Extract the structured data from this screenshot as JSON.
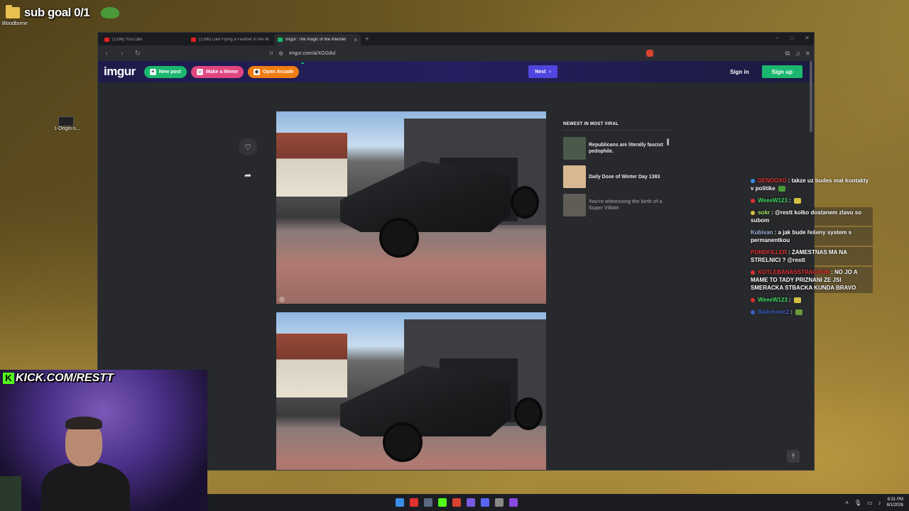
{
  "desktop": {
    "sub_goal": "sub goal 0/1",
    "folder_label": "Bloodborne",
    "app_label": "1-Origin-s..."
  },
  "browser": {
    "tabs": [
      {
        "title": "(1396) YouTube",
        "favicon_color": "#e02020",
        "active": false
      },
      {
        "title": "(1396) Like Flying a Feather in the W",
        "favicon_color": "#e02020",
        "active": false
      },
      {
        "title": "imgur: The magic of the Internet",
        "favicon_color": "#1bb76e",
        "active": true
      }
    ],
    "url": "imgur.com/a/XGGdul"
  },
  "imgur": {
    "logo": "imgur",
    "new_post": "New post",
    "make_meme": "Make a Meme",
    "open_arcade": "Open Arcade",
    "arcade_badge": "",
    "next": "Next",
    "sign_in": "Sign in",
    "sign_up": "Sign up",
    "viral_heading": "NEWEST IN MOST VIRAL",
    "viral_items": [
      {
        "title": "Republicans are literally fascist pedophile.",
        "thumb_color": "#4a5a4a"
      },
      {
        "title": "Daily Dose of Winter Day 1383",
        "thumb_color": "#d8b890"
      },
      {
        "title": "You're witnessing the birth of a Super Villain",
        "thumb_color": "#9a9080"
      }
    ]
  },
  "chat": [
    {
      "user": "DENDOXO",
      "user_color": "#e03030",
      "text": "takze uz budes mat kontakty v politike",
      "bg": false
    },
    {
      "user": "WeeeW123",
      "user_color": "#40d860",
      "text": "",
      "bg": false
    },
    {
      "user": "sokr",
      "user_color": "#a0e860",
      "text": "@restt kolko dostanem zlavu so subom",
      "bg": true
    },
    {
      "user": "Kubivan",
      "user_color": "#a0b8e0",
      "text": "a jak bude řešeny system s permanentkou",
      "bg": true
    },
    {
      "user": "PONDFILLER",
      "user_color": "#e03030",
      "text": "ZAMESTNAS MA NA STRELNICI ? @restt",
      "bg": true
    },
    {
      "user": "KOTLEBANASSTRACHON",
      "user_color": "#e03030",
      "text": "NO JO A MAME TO TADY PRIZNANI ZE JSI SMERACKA STBACKA KUNDA BRAVO",
      "bg": true
    },
    {
      "user": "WeeeW123",
      "user_color": "#40d860",
      "text": "",
      "bg": false
    },
    {
      "user": "Baiichavic2",
      "user_color": "#4060c0",
      "text": "",
      "bg": false
    }
  ],
  "stream": {
    "kick_url": "KICK.COM/RESTT"
  },
  "taskbar": {
    "time": "8:31 PM",
    "date": "8/1/2026",
    "icon_colors": [
      "#3b8ee8",
      "#e03030",
      "#5a6a80",
      "#53fc18",
      "#d9432f",
      "#7a5ae0",
      "#5865f2",
      "#888888",
      "#8a4ae0"
    ]
  }
}
